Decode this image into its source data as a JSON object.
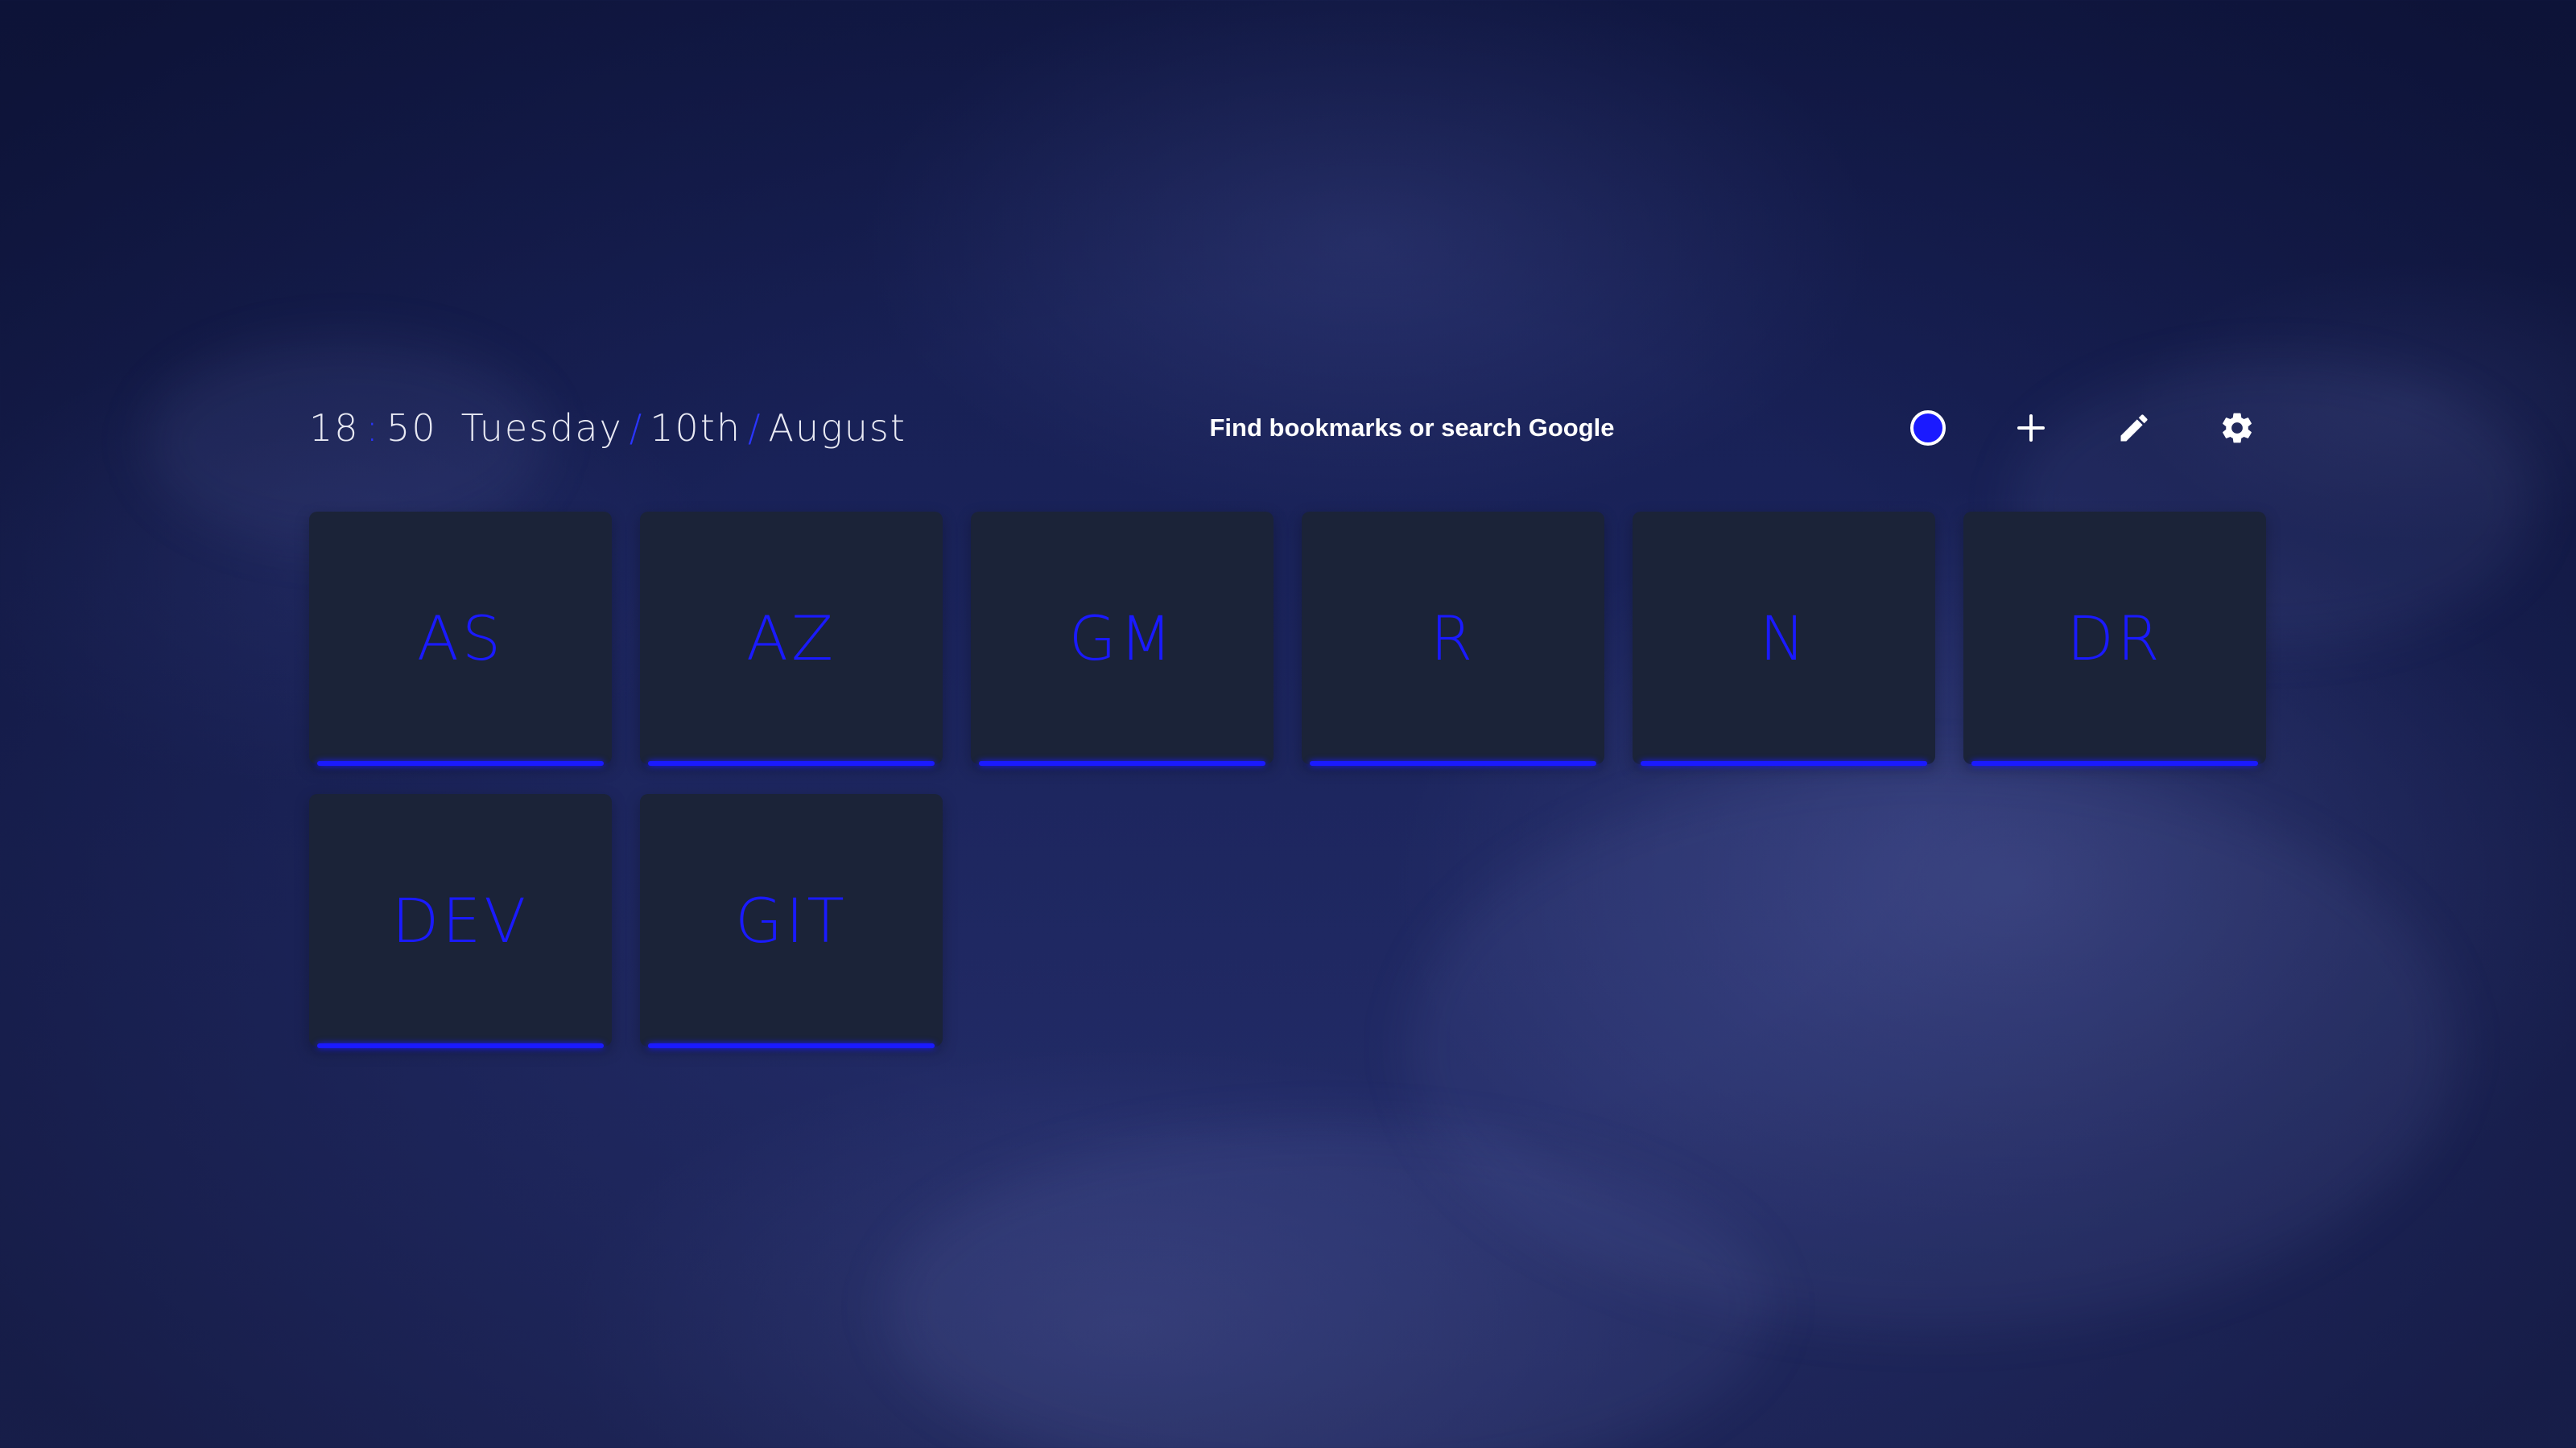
{
  "theme": {
    "accent": "#1a1aff",
    "tile_background": "#1b2338",
    "text": "#ffffff"
  },
  "datetime": {
    "hour": "18",
    "minute": "50",
    "weekday": "Tuesday",
    "day": "10th",
    "month": "August",
    "separator": "/"
  },
  "search": {
    "placeholder": "Find bookmarks or search Google"
  },
  "controls": [
    {
      "name": "theme-toggle",
      "icon": "theme-dot-icon"
    },
    {
      "name": "add-bookmark",
      "icon": "plus-icon"
    },
    {
      "name": "edit-bookmarks",
      "icon": "pencil-icon"
    },
    {
      "name": "settings",
      "icon": "gear-icon"
    }
  ],
  "bookmarks": [
    {
      "label": "AS"
    },
    {
      "label": "AZ"
    },
    {
      "label": "GM"
    },
    {
      "label": "R"
    },
    {
      "label": "N"
    },
    {
      "label": "DR"
    },
    {
      "label": "DEV"
    },
    {
      "label": "GIT"
    }
  ]
}
